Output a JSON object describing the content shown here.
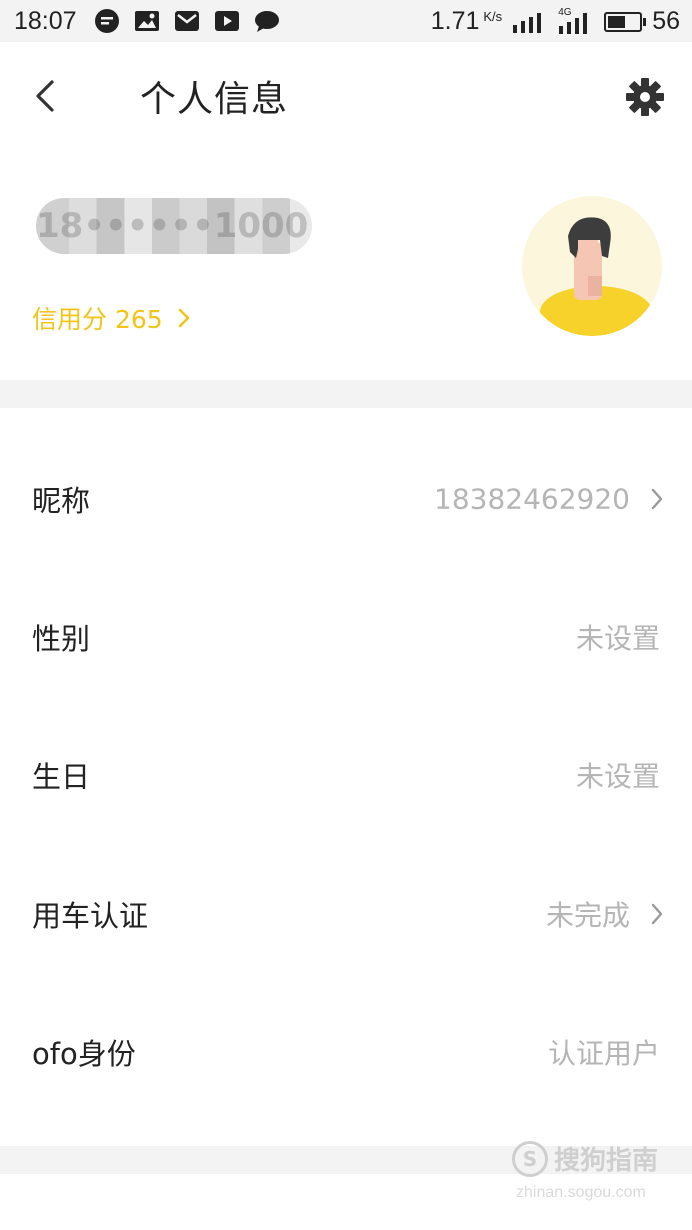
{
  "status_bar": {
    "time": "18:07",
    "net_speed": "1.71",
    "net_unit": "K/s",
    "network_type": "4G",
    "battery": "56",
    "battery_level": 0.56,
    "app_icons": [
      "message-icon",
      "picture-icon",
      "mail-icon",
      "video-icon",
      "chat-icon"
    ]
  },
  "nav": {
    "title": "个人信息",
    "back_icon": "back-arrow-icon",
    "settings_icon": "gear-icon"
  },
  "profile": {
    "phone_masked": "18••••••1000",
    "credit_label": "信用分 265"
  },
  "rows": [
    {
      "label": "昵称",
      "value": "18382462920",
      "chevron": true
    },
    {
      "label": "性别",
      "value": "未设置",
      "chevron": false
    },
    {
      "label": "生日",
      "value": "未设置",
      "chevron": false
    },
    {
      "label": "用车认证",
      "value": "未完成",
      "chevron": true
    },
    {
      "label": "ofo身份",
      "value": "认证用户",
      "chevron": false
    }
  ],
  "watermark": {
    "main": "搜狗指南",
    "sub": "zhinan.sogou.com"
  },
  "colors": {
    "accent": "#f2c418",
    "value_grey": "#b5b5b5",
    "divider": "#f3f3f3"
  }
}
